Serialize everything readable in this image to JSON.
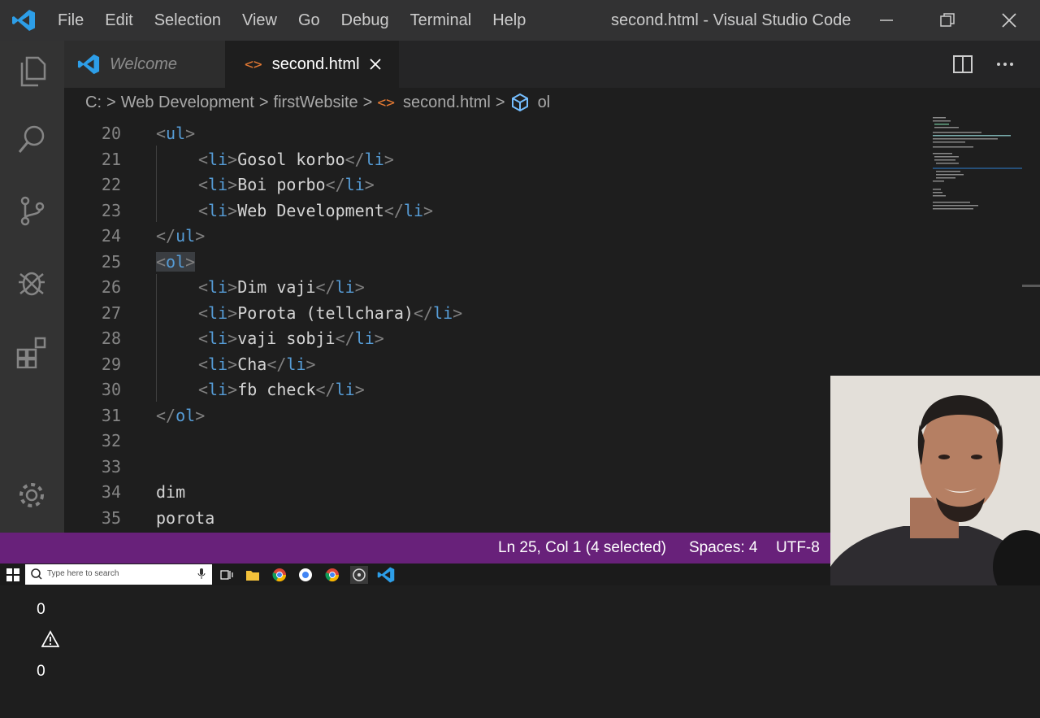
{
  "titlebar": {
    "menu": [
      "File",
      "Edit",
      "Selection",
      "View",
      "Go",
      "Debug",
      "Terminal",
      "Help"
    ],
    "window_title": "second.html - Visual Studio Code"
  },
  "tabs": [
    {
      "label": "Welcome",
      "active": false
    },
    {
      "label": "second.html",
      "active": true
    }
  ],
  "breadcrumb": [
    "C:",
    "Web Development",
    "firstWebsite",
    "second.html",
    "ol"
  ],
  "editor": {
    "lines": [
      {
        "num": "20",
        "indent": false,
        "open": "<",
        "tag": "ul",
        "close": ">",
        "text": "",
        "open2": "",
        "tag2": "",
        "close2": ""
      },
      {
        "num": "21",
        "indent": true,
        "open": "<",
        "tag": "li",
        "close": ">",
        "text": "Gosol korbo",
        "open2": "</",
        "tag2": "li",
        "close2": ">"
      },
      {
        "num": "22",
        "indent": true,
        "open": "<",
        "tag": "li",
        "close": ">",
        "text": "Boi porbo",
        "open2": "</",
        "tag2": "li",
        "close2": ">"
      },
      {
        "num": "23",
        "indent": true,
        "open": "<",
        "tag": "li",
        "close": ">",
        "text": "Web Development",
        "open2": "</",
        "tag2": "li",
        "close2": ">"
      },
      {
        "num": "24",
        "indent": false,
        "open": "</",
        "tag": "ul",
        "close": ">",
        "text": "",
        "open2": "",
        "tag2": "",
        "close2": ""
      },
      {
        "num": "25",
        "indent": false,
        "open": "<",
        "tag": "ol",
        "close": ">",
        "text": "",
        "open2": "",
        "tag2": "",
        "close2": ""
      },
      {
        "num": "26",
        "indent": true,
        "open": "<",
        "tag": "li",
        "close": ">",
        "text": "Dim vaji",
        "open2": "</",
        "tag2": "li",
        "close2": ">"
      },
      {
        "num": "27",
        "indent": true,
        "open": "<",
        "tag": "li",
        "close": ">",
        "text": "Porota (tellchara)",
        "open2": "</",
        "tag2": "li",
        "close2": ">"
      },
      {
        "num": "28",
        "indent": true,
        "open": "<",
        "tag": "li",
        "close": ">",
        "text": "vaji sobji",
        "open2": "</",
        "tag2": "li",
        "close2": ">"
      },
      {
        "num": "29",
        "indent": true,
        "open": "<",
        "tag": "li",
        "close": ">",
        "text": "Cha",
        "open2": "</",
        "tag2": "li",
        "close2": ">"
      },
      {
        "num": "30",
        "indent": true,
        "open": "<",
        "tag": "li",
        "close": ">",
        "text": "fb check",
        "open2": "</",
        "tag2": "li",
        "close2": ">"
      },
      {
        "num": "31",
        "indent": false,
        "open": "</",
        "tag": "ol",
        "close": ">",
        "text": "",
        "open2": "",
        "tag2": "",
        "close2": ""
      },
      {
        "num": "32",
        "indent": false,
        "open": "",
        "tag": "",
        "close": "",
        "text": "",
        "open2": "",
        "tag2": "",
        "close2": ""
      },
      {
        "num": "33",
        "indent": false,
        "open": "",
        "tag": "",
        "close": "",
        "text": "",
        "open2": "",
        "tag2": "",
        "close2": ""
      },
      {
        "num": "34",
        "indent": false,
        "open": "",
        "tag": "",
        "close": "",
        "text": "dim",
        "open2": "",
        "tag2": "",
        "close2": ""
      },
      {
        "num": "35",
        "indent": false,
        "open": "",
        "tag": "",
        "close": "",
        "text": "porota",
        "open2": "",
        "tag2": "",
        "close2": ""
      }
    ],
    "selected_line": "25"
  },
  "statusbar": {
    "errors": "0",
    "warnings": "0",
    "position": "Ln 25, Col 1 (4 selected)",
    "spaces": "Spaces: 4",
    "encoding": "UTF-8"
  },
  "taskbar": {
    "search_placeholder": "Type here to search"
  },
  "colors": {
    "statusbar": "#68217a",
    "tag": "#569cd6",
    "punctuation": "#808080",
    "text": "#d4d4d4"
  }
}
